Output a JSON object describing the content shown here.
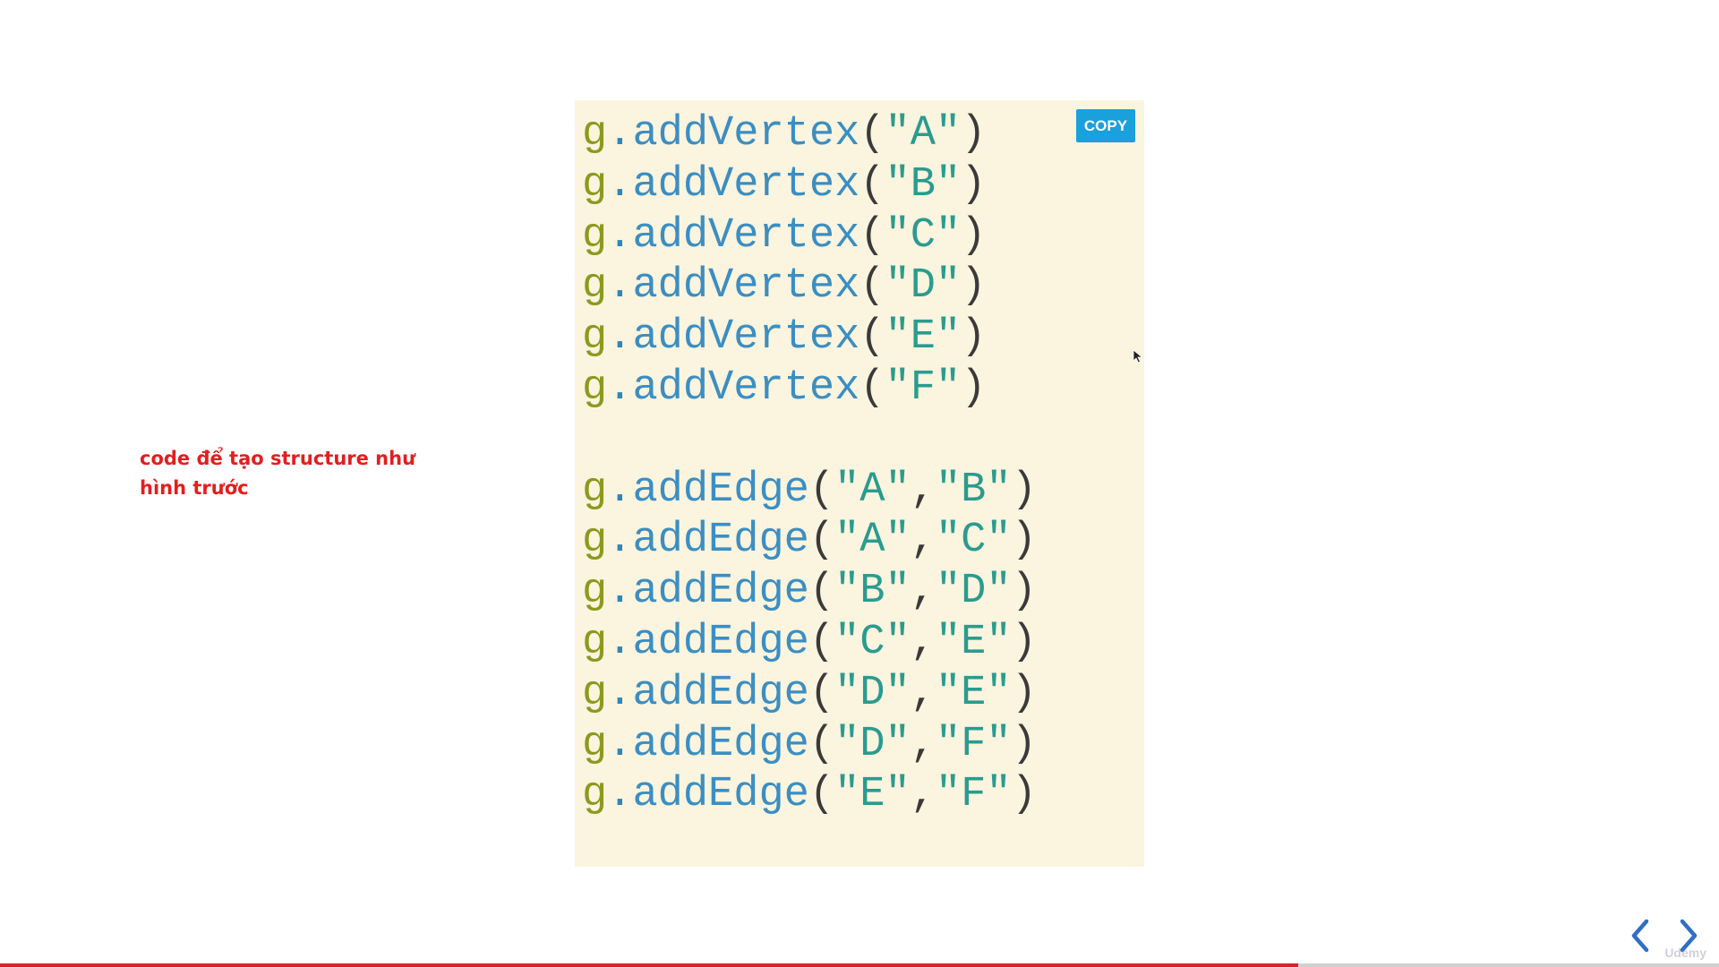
{
  "note": {
    "text": "code để tạo structure như hình trước"
  },
  "code_block": {
    "copy_label": "COPY",
    "object_name": "g",
    "vertex_lines": [
      {
        "method": "addVertex",
        "args": [
          "A"
        ]
      },
      {
        "method": "addVertex",
        "args": [
          "B"
        ]
      },
      {
        "method": "addVertex",
        "args": [
          "C"
        ]
      },
      {
        "method": "addVertex",
        "args": [
          "D"
        ]
      },
      {
        "method": "addVertex",
        "args": [
          "E"
        ]
      },
      {
        "method": "addVertex",
        "args": [
          "F"
        ]
      }
    ],
    "edge_lines": [
      {
        "method": "addEdge",
        "args": [
          "A",
          "B"
        ]
      },
      {
        "method": "addEdge",
        "args": [
          "A",
          "C"
        ]
      },
      {
        "method": "addEdge",
        "args": [
          "B",
          "D"
        ]
      },
      {
        "method": "addEdge",
        "args": [
          "C",
          "E"
        ]
      },
      {
        "method": "addEdge",
        "args": [
          "D",
          "E"
        ]
      },
      {
        "method": "addEdge",
        "args": [
          "D",
          "F"
        ]
      },
      {
        "method": "addEdge",
        "args": [
          "E",
          "F"
        ]
      }
    ]
  },
  "player": {
    "progress": 0.755,
    "prev_icon": "chevron-left-icon",
    "next_icon": "chevron-right-icon",
    "watermark": "Udemy"
  },
  "colors": {
    "note_text": "#e0201f",
    "code_background": "#fbf4de",
    "copy_button": "#1aa0db",
    "string_literal": "#2a9b8f",
    "method_name": "#3b8ec2",
    "object_name": "#8a9a1e",
    "progress_fill": "#d4262a",
    "nav_arrow": "#2f6fc4"
  }
}
